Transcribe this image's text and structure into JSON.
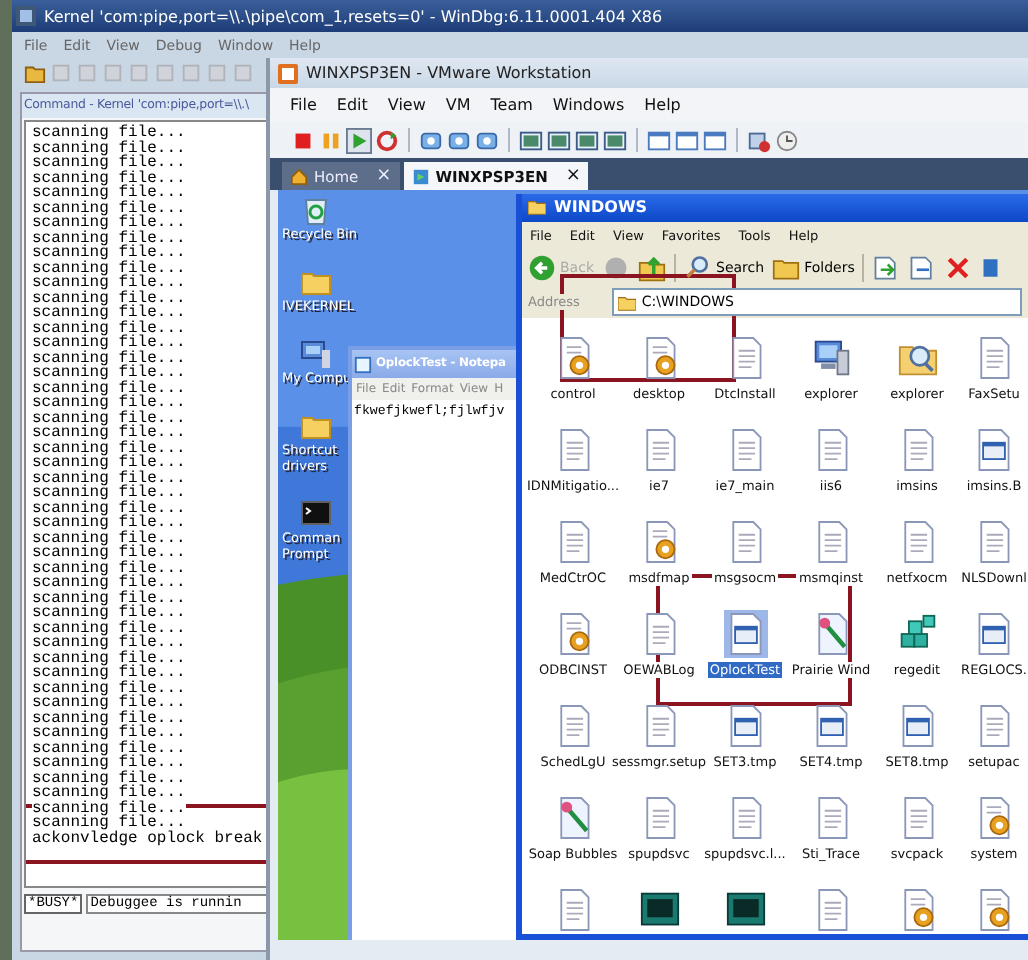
{
  "windbg": {
    "title": "Kernel 'com:pipe,port=\\\\.\\pipe\\com_1,resets=0' - WinDbg:6.11.0001.404 X86",
    "menu": [
      "File",
      "Edit",
      "View",
      "Debug",
      "Window",
      "Help"
    ],
    "command_window": {
      "title": "Command - Kernel 'com:pipe,port=\\\\.\\",
      "lines": [
        "scanning file...",
        "scanning file...",
        "scanning file...",
        "scanning file...",
        "scanning file...",
        "scanning file...",
        "scanning file...",
        "scanning file...",
        "scanning file...",
        "scanning file...",
        "scanning file...",
        "scanning file...",
        "scanning file...",
        "scanning file...",
        "scanning file...",
        "scanning file...",
        "scanning file...",
        "scanning file...",
        "scanning file...",
        "scanning file...",
        "scanning file...",
        "scanning file...",
        "scanning file...",
        "scanning file...",
        "scanning file...",
        "scanning file...",
        "scanning file...",
        "scanning file...",
        "scanning file...",
        "scanning file...",
        "scanning file...",
        "scanning file...",
        "scanning file...",
        "scanning file...",
        "scanning file...",
        "scanning file...",
        "scanning file...",
        "scanning file...",
        "scanning file...",
        "scanning file...",
        "scanning file...",
        "scanning file...",
        "scanning file...",
        "scanning file...",
        "scanning file...",
        "scanning file...",
        "scanning file...",
        "ackonvledge oplock break"
      ],
      "status": {
        "state": "*BUSY*",
        "message": "Debuggee is runnin"
      }
    }
  },
  "vmware": {
    "title": "WINXPSP3EN - VMware Workstation",
    "menu": [
      "File",
      "Edit",
      "View",
      "VM",
      "Team",
      "Windows",
      "Help"
    ],
    "tabs": [
      {
        "label": "Home",
        "close": "×",
        "selected": false
      },
      {
        "label": "WINXPSP3EN",
        "close": "×",
        "selected": true
      }
    ],
    "guest": {
      "desktop_icons": [
        {
          "kind": "recycle",
          "lines": [
            "Recycle Bin"
          ]
        },
        {
          "kind": "folder",
          "lines": [
            "IVEKERNEL"
          ]
        },
        {
          "kind": "computer",
          "lines": [
            "My Compu"
          ]
        },
        {
          "kind": "folder",
          "lines": [
            "Shortcut",
            "drivers"
          ]
        },
        {
          "kind": "console",
          "lines": [
            "Comman",
            "Prompt"
          ]
        }
      ],
      "notepad": {
        "title": "OplockTest - Notepa",
        "menu": [
          "File",
          "Edit",
          "Format",
          "View",
          "H"
        ],
        "text": "fkwefjkwefl;fjlwfjv"
      },
      "explorer": {
        "title": "WINDOWS",
        "menu": [
          "File",
          "Edit",
          "View",
          "Favorites",
          "Tools",
          "Help"
        ],
        "back": "Back",
        "search": "Search",
        "folders": "Folders",
        "address_label": "Address",
        "address": "C:\\WINDOWS",
        "files": [
          {
            "name": "control",
            "kind": "gear",
            "selected": false
          },
          {
            "name": "desktop",
            "kind": "gear",
            "selected": false
          },
          {
            "name": "DtcInstall",
            "kind": "doc",
            "selected": false
          },
          {
            "name": "explorer",
            "kind": "computer",
            "selected": false
          },
          {
            "name": "explorer",
            "kind": "search",
            "selected": false
          },
          {
            "name": "FaxSetu",
            "kind": "doc",
            "selected": false
          },
          {
            "name": "IDNMitigatio...",
            "kind": "doc",
            "selected": false
          },
          {
            "name": "ie7",
            "kind": "doc",
            "selected": false
          },
          {
            "name": "ie7_main",
            "kind": "doc",
            "selected": false
          },
          {
            "name": "iis6",
            "kind": "doc",
            "selected": false
          },
          {
            "name": "imsins",
            "kind": "doc",
            "selected": false
          },
          {
            "name": "imsins.B",
            "kind": "window",
            "selected": false
          },
          {
            "name": "MedCtrOC",
            "kind": "doc",
            "selected": false
          },
          {
            "name": "msdfmap",
            "kind": "gear",
            "selected": false
          },
          {
            "name": "msgsocm",
            "kind": "doc",
            "selected": false
          },
          {
            "name": "msmqinst",
            "kind": "doc",
            "selected": false
          },
          {
            "name": "netfxocm",
            "kind": "doc",
            "selected": false
          },
          {
            "name": "NLSDownl",
            "kind": "doc",
            "selected": false
          },
          {
            "name": "ODBCINST",
            "kind": "gear",
            "selected": false
          },
          {
            "name": "OEWABLog",
            "kind": "doc",
            "selected": false
          },
          {
            "name": "OplockTest",
            "kind": "window",
            "selected": true
          },
          {
            "name": "Prairie Wind",
            "kind": "brush",
            "selected": false
          },
          {
            "name": "regedit",
            "kind": "cubes",
            "selected": false
          },
          {
            "name": "REGLOCS.",
            "kind": "window",
            "selected": false
          },
          {
            "name": "SchedLgU",
            "kind": "doc",
            "selected": false
          },
          {
            "name": "sessmgr.setup",
            "kind": "doc",
            "selected": false
          },
          {
            "name": "SET3.tmp",
            "kind": "window",
            "selected": false
          },
          {
            "name": "SET4.tmp",
            "kind": "window",
            "selected": false
          },
          {
            "name": "SET8.tmp",
            "kind": "window",
            "selected": false
          },
          {
            "name": "setupac",
            "kind": "doc",
            "selected": false
          },
          {
            "name": "Soap Bubbles",
            "kind": "brush",
            "selected": false
          },
          {
            "name": "spupdsvc",
            "kind": "doc",
            "selected": false
          },
          {
            "name": "spupdsvc.l...",
            "kind": "doc",
            "selected": false
          },
          {
            "name": "Sti_Trace",
            "kind": "doc",
            "selected": false
          },
          {
            "name": "svcpack",
            "kind": "doc",
            "selected": false
          },
          {
            "name": "system",
            "kind": "gear",
            "selected": false
          },
          {
            "kind": "doc",
            "selected": false
          },
          {
            "kind": "screen",
            "selected": false
          },
          {
            "kind": "screen",
            "selected": false
          },
          {
            "kind": "doc",
            "selected": false
          },
          {
            "kind": "gear",
            "selected": false
          },
          {
            "kind": "gear",
            "selected": false
          }
        ]
      }
    }
  }
}
